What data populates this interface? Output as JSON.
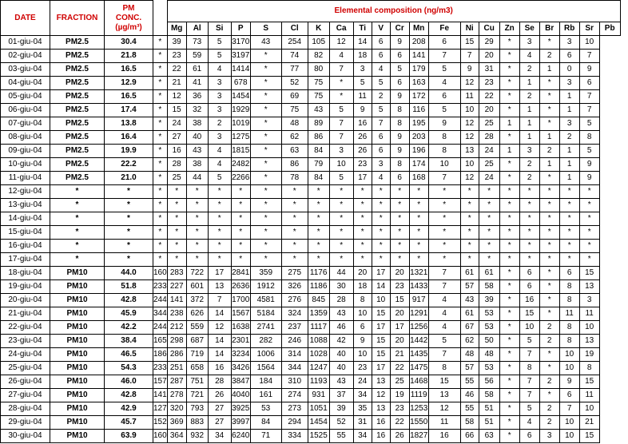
{
  "header": {
    "date": "DATE",
    "fraction": "FRACTION",
    "pm_line1": "PM",
    "pm_line2": "CONC.",
    "pm_unit": "(µg/m³)",
    "elemental": "Elemental composition (ng/m3)"
  },
  "elements": [
    "Mg",
    "Al",
    "Si",
    "P",
    "S",
    "Cl",
    "K",
    "Ca",
    "Ti",
    "V",
    "Cr",
    "Mn",
    "Fe",
    "Ni",
    "Cu",
    "Zn",
    "Se",
    "Br",
    "Rb",
    "Sr",
    "Pb"
  ],
  "rows": [
    {
      "date": "01-giu-04",
      "fraction": "PM2.5",
      "pm": "30.4",
      "vals": [
        "*",
        "39",
        "73",
        "5",
        "3170",
        "43",
        "254",
        "105",
        "12",
        "14",
        "6",
        "9",
        "208",
        "6",
        "15",
        "29",
        "*",
        "3",
        "*",
        "3",
        "10"
      ]
    },
    {
      "date": "02-giu-04",
      "fraction": "PM2.5",
      "pm": "21.8",
      "vals": [
        "*",
        "23",
        "59",
        "5",
        "3197",
        "*",
        "74",
        "82",
        "4",
        "18",
        "6",
        "6",
        "141",
        "7",
        "7",
        "20",
        "*",
        "4",
        "2",
        "6",
        "7"
      ]
    },
    {
      "date": "03-giu-04",
      "fraction": "PM2.5",
      "pm": "16.5",
      "vals": [
        "*",
        "22",
        "61",
        "4",
        "1414",
        "*",
        "77",
        "80",
        "7",
        "3",
        "4",
        "5",
        "179",
        "5",
        "9",
        "31",
        "*",
        "2",
        "1",
        "0",
        "9"
      ]
    },
    {
      "date": "04-giu-04",
      "fraction": "PM2.5",
      "pm": "12.9",
      "vals": [
        "*",
        "21",
        "41",
        "3",
        "678",
        "*",
        "52",
        "75",
        "*",
        "5",
        "5",
        "6",
        "163",
        "4",
        "12",
        "23",
        "*",
        "1",
        "*",
        "3",
        "6"
      ]
    },
    {
      "date": "05-giu-04",
      "fraction": "PM2.5",
      "pm": "16.5",
      "vals": [
        "*",
        "12",
        "36",
        "3",
        "1454",
        "*",
        "69",
        "75",
        "*",
        "11",
        "2",
        "9",
        "172",
        "6",
        "11",
        "22",
        "*",
        "2",
        "*",
        "1",
        "7"
      ]
    },
    {
      "date": "06-giu-04",
      "fraction": "PM2.5",
      "pm": "17.4",
      "vals": [
        "*",
        "15",
        "32",
        "3",
        "1929",
        "*",
        "75",
        "43",
        "5",
        "9",
        "5",
        "8",
        "116",
        "5",
        "10",
        "20",
        "*",
        "1",
        "*",
        "1",
        "7"
      ]
    },
    {
      "date": "07-giu-04",
      "fraction": "PM2.5",
      "pm": "13.8",
      "vals": [
        "*",
        "24",
        "38",
        "2",
        "1019",
        "*",
        "48",
        "89",
        "7",
        "16",
        "7",
        "8",
        "195",
        "9",
        "12",
        "25",
        "1",
        "1",
        "*",
        "3",
        "5"
      ]
    },
    {
      "date": "08-giu-04",
      "fraction": "PM2.5",
      "pm": "16.4",
      "vals": [
        "*",
        "27",
        "40",
        "3",
        "1275",
        "*",
        "62",
        "86",
        "7",
        "26",
        "6",
        "9",
        "203",
        "8",
        "12",
        "28",
        "*",
        "1",
        "1",
        "2",
        "8"
      ]
    },
    {
      "date": "09-giu-04",
      "fraction": "PM2.5",
      "pm": "19.9",
      "vals": [
        "*",
        "16",
        "43",
        "4",
        "1815",
        "*",
        "63",
        "84",
        "3",
        "26",
        "6",
        "9",
        "196",
        "8",
        "13",
        "24",
        "1",
        "3",
        "2",
        "1",
        "5"
      ]
    },
    {
      "date": "10-giu-04",
      "fraction": "PM2.5",
      "pm": "22.2",
      "vals": [
        "*",
        "28",
        "38",
        "4",
        "2482",
        "*",
        "86",
        "79",
        "10",
        "23",
        "3",
        "8",
        "174",
        "10",
        "10",
        "25",
        "*",
        "2",
        "1",
        "1",
        "9"
      ]
    },
    {
      "date": "11-giu-04",
      "fraction": "PM2.5",
      "pm": "21.0",
      "vals": [
        "*",
        "25",
        "44",
        "5",
        "2266",
        "*",
        "78",
        "84",
        "5",
        "17",
        "4",
        "6",
        "168",
        "7",
        "12",
        "24",
        "*",
        "2",
        "*",
        "1",
        "9"
      ]
    },
    {
      "date": "12-giu-04",
      "fraction": "*",
      "pm": "*",
      "vals": [
        "*",
        "*",
        "*",
        "*",
        "*",
        "*",
        "*",
        "*",
        "*",
        "*",
        "*",
        "*",
        "*",
        "*",
        "*",
        "*",
        "*",
        "*",
        "*",
        "*",
        "*"
      ]
    },
    {
      "date": "13-giu-04",
      "fraction": "*",
      "pm": "*",
      "vals": [
        "*",
        "*",
        "*",
        "*",
        "*",
        "*",
        "*",
        "*",
        "*",
        "*",
        "*",
        "*",
        "*",
        "*",
        "*",
        "*",
        "*",
        "*",
        "*",
        "*",
        "*"
      ]
    },
    {
      "date": "14-giu-04",
      "fraction": "*",
      "pm": "*",
      "vals": [
        "*",
        "*",
        "*",
        "*",
        "*",
        "*",
        "*",
        "*",
        "*",
        "*",
        "*",
        "*",
        "*",
        "*",
        "*",
        "*",
        "*",
        "*",
        "*",
        "*",
        "*"
      ]
    },
    {
      "date": "15-giu-04",
      "fraction": "*",
      "pm": "*",
      "vals": [
        "*",
        "*",
        "*",
        "*",
        "*",
        "*",
        "*",
        "*",
        "*",
        "*",
        "*",
        "*",
        "*",
        "*",
        "*",
        "*",
        "*",
        "*",
        "*",
        "*",
        "*"
      ]
    },
    {
      "date": "16-giu-04",
      "fraction": "*",
      "pm": "*",
      "vals": [
        "*",
        "*",
        "*",
        "*",
        "*",
        "*",
        "*",
        "*",
        "*",
        "*",
        "*",
        "*",
        "*",
        "*",
        "*",
        "*",
        "*",
        "*",
        "*",
        "*",
        "*"
      ]
    },
    {
      "date": "17-giu-04",
      "fraction": "*",
      "pm": "*",
      "vals": [
        "*",
        "*",
        "*",
        "*",
        "*",
        "*",
        "*",
        "*",
        "*",
        "*",
        "*",
        "*",
        "*",
        "*",
        "*",
        "*",
        "*",
        "*",
        "*",
        "*",
        "*"
      ]
    },
    {
      "date": "18-giu-04",
      "fraction": "PM10",
      "pm": "44.0",
      "vals": [
        "160",
        "283",
        "722",
        "17",
        "2841",
        "359",
        "275",
        "1176",
        "44",
        "20",
        "17",
        "20",
        "1321",
        "7",
        "61",
        "61",
        "*",
        "6",
        "*",
        "6",
        "15"
      ]
    },
    {
      "date": "19-giu-04",
      "fraction": "PM10",
      "pm": "51.8",
      "vals": [
        "233",
        "227",
        "601",
        "13",
        "2636",
        "1912",
        "326",
        "1186",
        "30",
        "18",
        "14",
        "23",
        "1433",
        "7",
        "57",
        "58",
        "*",
        "6",
        "*",
        "8",
        "13"
      ]
    },
    {
      "date": "20-giu-04",
      "fraction": "PM10",
      "pm": "42.8",
      "vals": [
        "244",
        "141",
        "372",
        "7",
        "1700",
        "4581",
        "276",
        "845",
        "28",
        "8",
        "10",
        "15",
        "917",
        "4",
        "43",
        "39",
        "*",
        "16",
        "*",
        "8",
        "3"
      ]
    },
    {
      "date": "21-giu-04",
      "fraction": "PM10",
      "pm": "45.9",
      "vals": [
        "344",
        "238",
        "626",
        "14",
        "1567",
        "5184",
        "324",
        "1359",
        "43",
        "10",
        "15",
        "20",
        "1291",
        "4",
        "61",
        "53",
        "*",
        "15",
        "*",
        "11",
        "11"
      ]
    },
    {
      "date": "22-giu-04",
      "fraction": "PM10",
      "pm": "42.2",
      "vals": [
        "244",
        "212",
        "559",
        "12",
        "1638",
        "2741",
        "237",
        "1117",
        "46",
        "6",
        "17",
        "17",
        "1256",
        "4",
        "67",
        "53",
        "*",
        "10",
        "2",
        "8",
        "10"
      ]
    },
    {
      "date": "23-giu-04",
      "fraction": "PM10",
      "pm": "38.4",
      "vals": [
        "165",
        "298",
        "687",
        "14",
        "2301",
        "282",
        "246",
        "1088",
        "42",
        "9",
        "15",
        "20",
        "1442",
        "5",
        "62",
        "50",
        "*",
        "5",
        "2",
        "8",
        "13"
      ]
    },
    {
      "date": "24-giu-04",
      "fraction": "PM10",
      "pm": "46.5",
      "vals": [
        "186",
        "286",
        "719",
        "14",
        "3234",
        "1006",
        "314",
        "1028",
        "40",
        "10",
        "15",
        "21",
        "1435",
        "7",
        "48",
        "48",
        "*",
        "7",
        "*",
        "10",
        "19"
      ]
    },
    {
      "date": "25-giu-04",
      "fraction": "PM10",
      "pm": "54.3",
      "vals": [
        "233",
        "251",
        "658",
        "16",
        "3426",
        "1564",
        "344",
        "1247",
        "40",
        "23",
        "17",
        "22",
        "1475",
        "8",
        "57",
        "53",
        "*",
        "8",
        "*",
        "10",
        "8"
      ]
    },
    {
      "date": "26-giu-04",
      "fraction": "PM10",
      "pm": "46.0",
      "vals": [
        "157",
        "287",
        "751",
        "28",
        "3847",
        "184",
        "310",
        "1193",
        "43",
        "24",
        "13",
        "25",
        "1468",
        "15",
        "55",
        "56",
        "*",
        "7",
        "2",
        "9",
        "15"
      ]
    },
    {
      "date": "27-giu-04",
      "fraction": "PM10",
      "pm": "42.8",
      "vals": [
        "141",
        "278",
        "721",
        "26",
        "4040",
        "161",
        "274",
        "931",
        "37",
        "34",
        "12",
        "19",
        "1119",
        "13",
        "46",
        "58",
        "*",
        "7",
        "*",
        "6",
        "11"
      ]
    },
    {
      "date": "28-giu-04",
      "fraction": "PM10",
      "pm": "42.9",
      "vals": [
        "127",
        "320",
        "793",
        "27",
        "3925",
        "53",
        "273",
        "1051",
        "39",
        "35",
        "13",
        "23",
        "1253",
        "12",
        "55",
        "51",
        "*",
        "5",
        "2",
        "7",
        "10"
      ]
    },
    {
      "date": "29-giu-04",
      "fraction": "PM10",
      "pm": "45.7",
      "vals": [
        "152",
        "369",
        "883",
        "27",
        "3997",
        "84",
        "294",
        "1454",
        "52",
        "31",
        "16",
        "22",
        "1550",
        "11",
        "58",
        "51",
        "*",
        "4",
        "2",
        "10",
        "21"
      ]
    },
    {
      "date": "30-giu-04",
      "fraction": "PM10",
      "pm": "63.9",
      "vals": [
        "160",
        "364",
        "932",
        "34",
        "6240",
        "71",
        "334",
        "1525",
        "55",
        "34",
        "16",
        "26",
        "1827",
        "16",
        "66",
        "63",
        "*",
        "6",
        "3",
        "10",
        "15"
      ]
    }
  ]
}
